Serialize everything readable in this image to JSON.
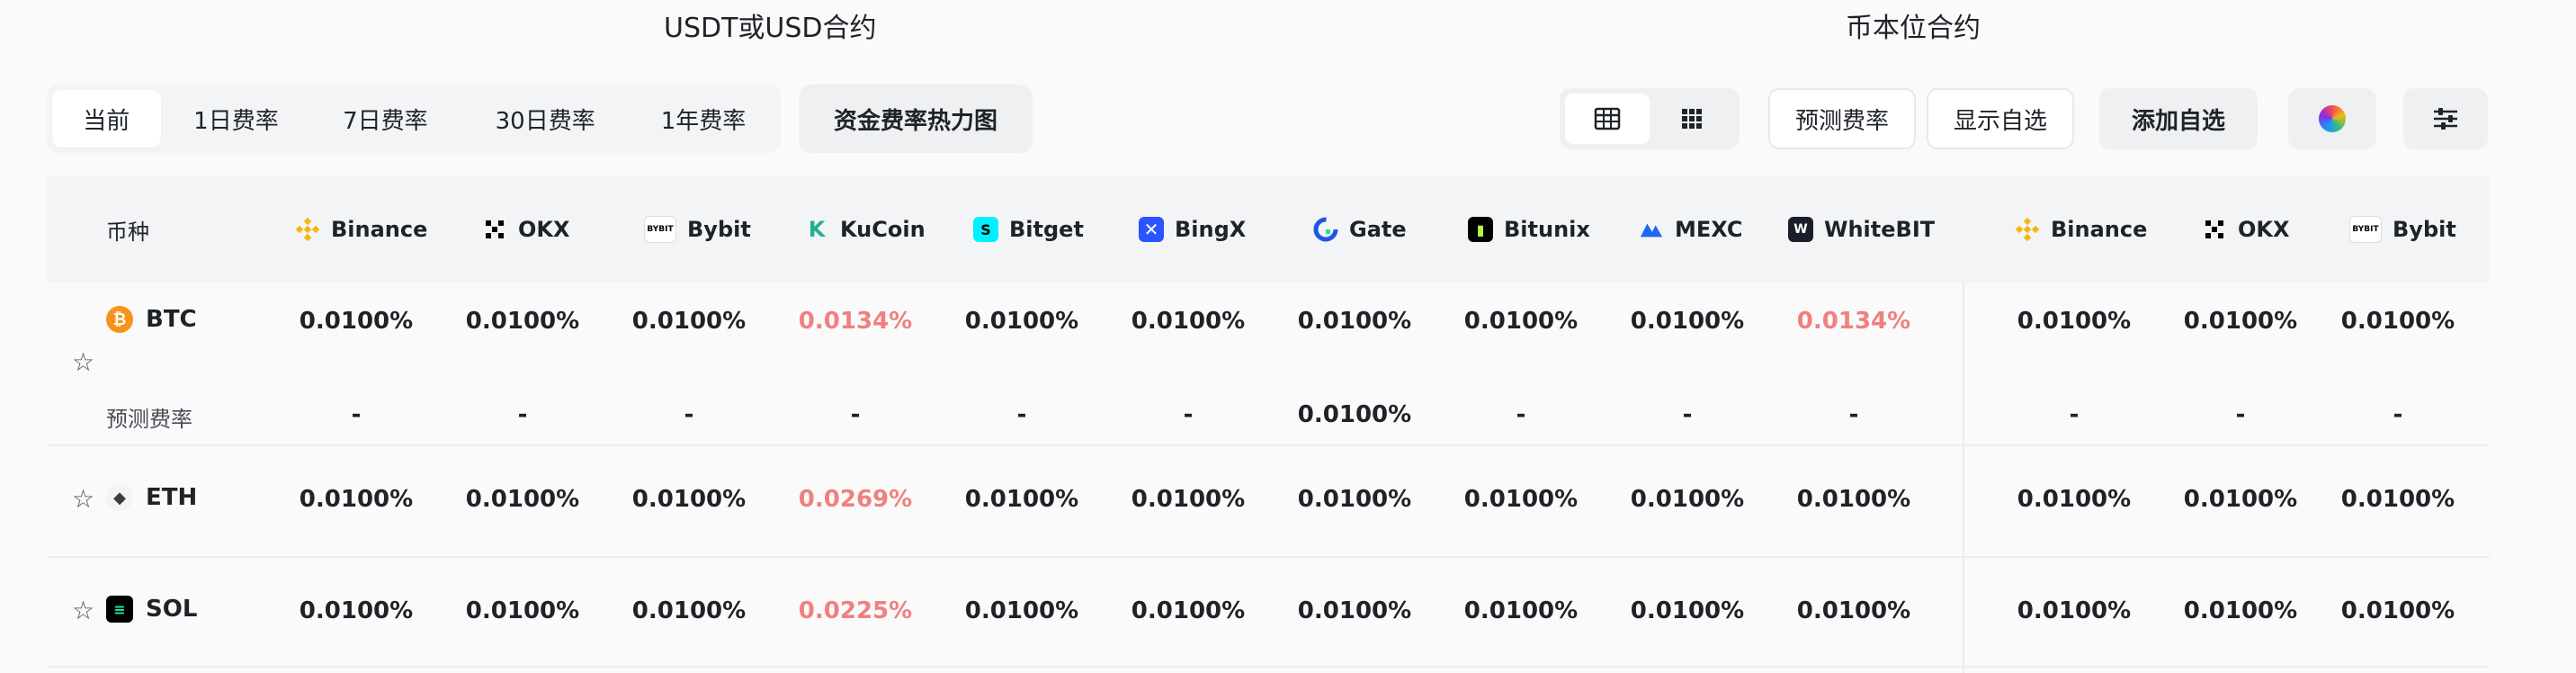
{
  "groups": {
    "usdt": "USDT或USD合约",
    "coin": "币本位合约"
  },
  "tabs": [
    "当前",
    "1日费率",
    "7日费率",
    "30日费率",
    "1年费率"
  ],
  "heatmap_button": "资金费率热力图",
  "toolbar": {
    "predict": "预测费率",
    "show_fav": "显示自选",
    "add_fav": "添加自选"
  },
  "header": {
    "coin_col": "币种",
    "exchanges": [
      "Binance",
      "OKX",
      "Bybit",
      "KuCoin",
      "Bitget",
      "BingX",
      "Gate",
      "Bitunix",
      "MEXC",
      "WhiteBIT",
      "Binance",
      "OKX",
      "Bybit"
    ]
  },
  "rows": [
    {
      "symbol": "BTC",
      "rates": [
        "0.0100%",
        "0.0100%",
        "0.0100%",
        "0.0134%",
        "0.0100%",
        "0.0100%",
        "0.0100%",
        "0.0100%",
        "0.0100%",
        "0.0134%",
        "0.0100%",
        "0.0100%",
        "0.0100%"
      ],
      "predicted_label": "预测费率",
      "predicted": [
        "-",
        "-",
        "-",
        "-",
        "-",
        "-",
        "0.0100%",
        "-",
        "-",
        "-",
        "-",
        "-",
        "-"
      ]
    },
    {
      "symbol": "ETH",
      "rates": [
        "0.0100%",
        "0.0100%",
        "0.0100%",
        "0.0269%",
        "0.0100%",
        "0.0100%",
        "0.0100%",
        "0.0100%",
        "0.0100%",
        "0.0100%",
        "0.0100%",
        "0.0100%",
        "0.0100%"
      ]
    },
    {
      "symbol": "SOL",
      "rates": [
        "0.0100%",
        "0.0100%",
        "0.0100%",
        "0.0225%",
        "0.0100%",
        "0.0100%",
        "0.0100%",
        "0.0100%",
        "0.0100%",
        "0.0100%",
        "0.0100%",
        "0.0100%",
        "0.0100%"
      ]
    }
  ],
  "colors": {
    "highlight": "#f08080",
    "text": "#1e2329",
    "header_bg": "#f3f4f6"
  }
}
